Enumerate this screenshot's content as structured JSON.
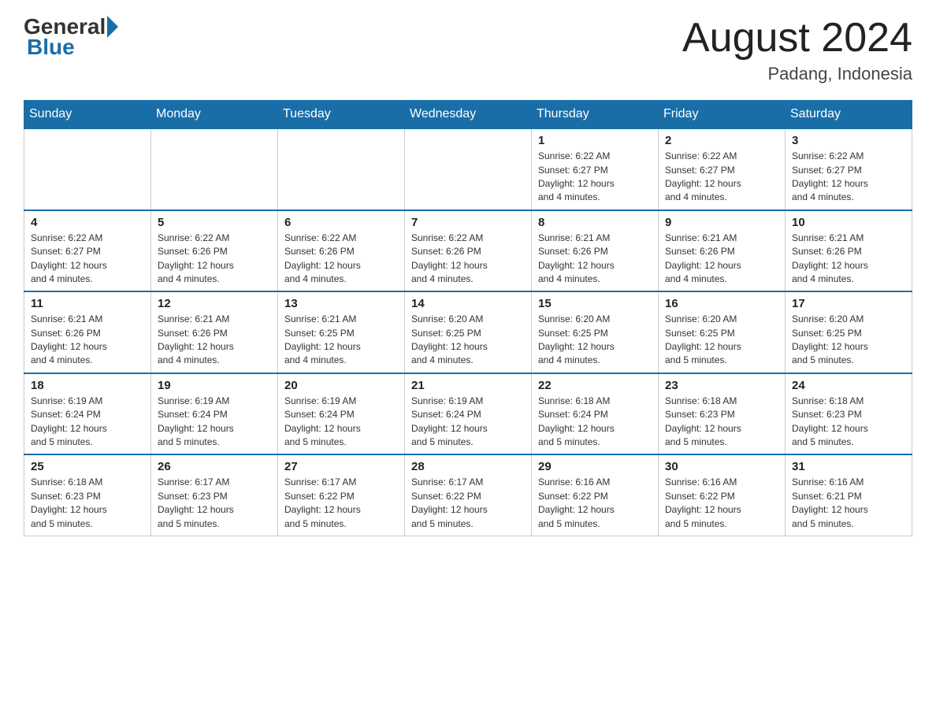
{
  "header": {
    "logo_general": "General",
    "logo_blue": "Blue",
    "title": "August 2024",
    "subtitle": "Padang, Indonesia"
  },
  "weekdays": [
    "Sunday",
    "Monday",
    "Tuesday",
    "Wednesday",
    "Thursday",
    "Friday",
    "Saturday"
  ],
  "weeks": [
    [
      {
        "day": "",
        "info": ""
      },
      {
        "day": "",
        "info": ""
      },
      {
        "day": "",
        "info": ""
      },
      {
        "day": "",
        "info": ""
      },
      {
        "day": "1",
        "info": "Sunrise: 6:22 AM\nSunset: 6:27 PM\nDaylight: 12 hours\nand 4 minutes."
      },
      {
        "day": "2",
        "info": "Sunrise: 6:22 AM\nSunset: 6:27 PM\nDaylight: 12 hours\nand 4 minutes."
      },
      {
        "day": "3",
        "info": "Sunrise: 6:22 AM\nSunset: 6:27 PM\nDaylight: 12 hours\nand 4 minutes."
      }
    ],
    [
      {
        "day": "4",
        "info": "Sunrise: 6:22 AM\nSunset: 6:27 PM\nDaylight: 12 hours\nand 4 minutes."
      },
      {
        "day": "5",
        "info": "Sunrise: 6:22 AM\nSunset: 6:26 PM\nDaylight: 12 hours\nand 4 minutes."
      },
      {
        "day": "6",
        "info": "Sunrise: 6:22 AM\nSunset: 6:26 PM\nDaylight: 12 hours\nand 4 minutes."
      },
      {
        "day": "7",
        "info": "Sunrise: 6:22 AM\nSunset: 6:26 PM\nDaylight: 12 hours\nand 4 minutes."
      },
      {
        "day": "8",
        "info": "Sunrise: 6:21 AM\nSunset: 6:26 PM\nDaylight: 12 hours\nand 4 minutes."
      },
      {
        "day": "9",
        "info": "Sunrise: 6:21 AM\nSunset: 6:26 PM\nDaylight: 12 hours\nand 4 minutes."
      },
      {
        "day": "10",
        "info": "Sunrise: 6:21 AM\nSunset: 6:26 PM\nDaylight: 12 hours\nand 4 minutes."
      }
    ],
    [
      {
        "day": "11",
        "info": "Sunrise: 6:21 AM\nSunset: 6:26 PM\nDaylight: 12 hours\nand 4 minutes."
      },
      {
        "day": "12",
        "info": "Sunrise: 6:21 AM\nSunset: 6:26 PM\nDaylight: 12 hours\nand 4 minutes."
      },
      {
        "day": "13",
        "info": "Sunrise: 6:21 AM\nSunset: 6:25 PM\nDaylight: 12 hours\nand 4 minutes."
      },
      {
        "day": "14",
        "info": "Sunrise: 6:20 AM\nSunset: 6:25 PM\nDaylight: 12 hours\nand 4 minutes."
      },
      {
        "day": "15",
        "info": "Sunrise: 6:20 AM\nSunset: 6:25 PM\nDaylight: 12 hours\nand 4 minutes."
      },
      {
        "day": "16",
        "info": "Sunrise: 6:20 AM\nSunset: 6:25 PM\nDaylight: 12 hours\nand 5 minutes."
      },
      {
        "day": "17",
        "info": "Sunrise: 6:20 AM\nSunset: 6:25 PM\nDaylight: 12 hours\nand 5 minutes."
      }
    ],
    [
      {
        "day": "18",
        "info": "Sunrise: 6:19 AM\nSunset: 6:24 PM\nDaylight: 12 hours\nand 5 minutes."
      },
      {
        "day": "19",
        "info": "Sunrise: 6:19 AM\nSunset: 6:24 PM\nDaylight: 12 hours\nand 5 minutes."
      },
      {
        "day": "20",
        "info": "Sunrise: 6:19 AM\nSunset: 6:24 PM\nDaylight: 12 hours\nand 5 minutes."
      },
      {
        "day": "21",
        "info": "Sunrise: 6:19 AM\nSunset: 6:24 PM\nDaylight: 12 hours\nand 5 minutes."
      },
      {
        "day": "22",
        "info": "Sunrise: 6:18 AM\nSunset: 6:24 PM\nDaylight: 12 hours\nand 5 minutes."
      },
      {
        "day": "23",
        "info": "Sunrise: 6:18 AM\nSunset: 6:23 PM\nDaylight: 12 hours\nand 5 minutes."
      },
      {
        "day": "24",
        "info": "Sunrise: 6:18 AM\nSunset: 6:23 PM\nDaylight: 12 hours\nand 5 minutes."
      }
    ],
    [
      {
        "day": "25",
        "info": "Sunrise: 6:18 AM\nSunset: 6:23 PM\nDaylight: 12 hours\nand 5 minutes."
      },
      {
        "day": "26",
        "info": "Sunrise: 6:17 AM\nSunset: 6:23 PM\nDaylight: 12 hours\nand 5 minutes."
      },
      {
        "day": "27",
        "info": "Sunrise: 6:17 AM\nSunset: 6:22 PM\nDaylight: 12 hours\nand 5 minutes."
      },
      {
        "day": "28",
        "info": "Sunrise: 6:17 AM\nSunset: 6:22 PM\nDaylight: 12 hours\nand 5 minutes."
      },
      {
        "day": "29",
        "info": "Sunrise: 6:16 AM\nSunset: 6:22 PM\nDaylight: 12 hours\nand 5 minutes."
      },
      {
        "day": "30",
        "info": "Sunrise: 6:16 AM\nSunset: 6:22 PM\nDaylight: 12 hours\nand 5 minutes."
      },
      {
        "day": "31",
        "info": "Sunrise: 6:16 AM\nSunset: 6:21 PM\nDaylight: 12 hours\nand 5 minutes."
      }
    ]
  ]
}
